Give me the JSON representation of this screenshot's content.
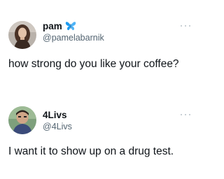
{
  "tweets": [
    {
      "display_name": "pam",
      "badge_icon": "butterfly-icon",
      "handle": "@pamelabarnik",
      "text": "how strong do you like your coffee?",
      "more_icon": "more-options-icon"
    },
    {
      "display_name": "4Livs",
      "handle": "@4Livs",
      "text": "I want it to show up on a drug test.",
      "more_icon": "more-options-icon"
    }
  ],
  "colors": {
    "text_primary": "#0f1419",
    "text_secondary": "#536471",
    "badge_blue": "#1d9bf0",
    "background": "#ffffff"
  }
}
